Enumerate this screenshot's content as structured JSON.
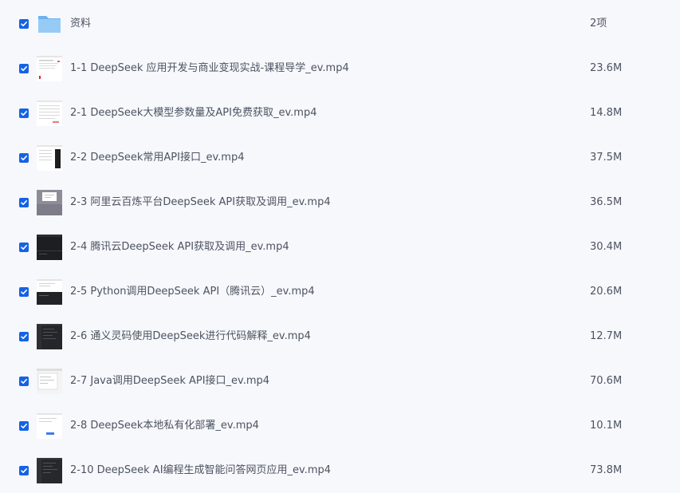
{
  "files": [
    {
      "name": "资料",
      "size": "2项",
      "icon": "folder-icon",
      "thumb": "folder"
    },
    {
      "name": "1-1 DeepSeek 应用开发与商业变现实战-课程导学_ev.mp4",
      "size": "23.6M",
      "icon": "video-thumbnail",
      "thumb": "white-red"
    },
    {
      "name": "2-1 DeepSeek大模型参数量及API免费获取_ev.mp4",
      "size": "14.8M",
      "icon": "video-thumbnail",
      "thumb": "white-doc"
    },
    {
      "name": "2-2 DeepSeek常用API接口_ev.mp4",
      "size": "37.5M",
      "icon": "video-thumbnail",
      "thumb": "white-dark"
    },
    {
      "name": "2-3 阿里云百炼平台DeepSeek API获取及调用_ev.mp4",
      "size": "36.5M",
      "icon": "video-thumbnail",
      "thumb": "gray-dialog"
    },
    {
      "name": "2-4 腾讯云DeepSeek API获取及调用_ev.mp4",
      "size": "30.4M",
      "icon": "video-thumbnail",
      "thumb": "dark"
    },
    {
      "name": "2-5 Python调用DeepSeek API（腾讯云）_ev.mp4",
      "size": "20.6M",
      "icon": "video-thumbnail",
      "thumb": "white-top-dark"
    },
    {
      "name": "2-6 通义灵码使用DeepSeek进行代码解释_ev.mp4",
      "size": "12.7M",
      "icon": "video-thumbnail",
      "thumb": "dark-ide"
    },
    {
      "name": "2-7 Java调用DeepSeek API接口_ev.mp4",
      "size": "70.6M",
      "icon": "video-thumbnail",
      "thumb": "white-window"
    },
    {
      "name": "2-8 DeepSeek本地私有化部署_ev.mp4",
      "size": "10.1M",
      "icon": "video-thumbnail",
      "thumb": "white-blue"
    },
    {
      "name": "2-10 DeepSeek AI编程生成智能问答网页应用_ev.mp4",
      "size": "73.8M",
      "icon": "video-thumbnail",
      "thumb": "dark-ide"
    }
  ],
  "colors": {
    "background": "#f7f8fc",
    "checkbox": "#1463e6",
    "text": "#4b5361",
    "folder": "#8ec5f5"
  }
}
